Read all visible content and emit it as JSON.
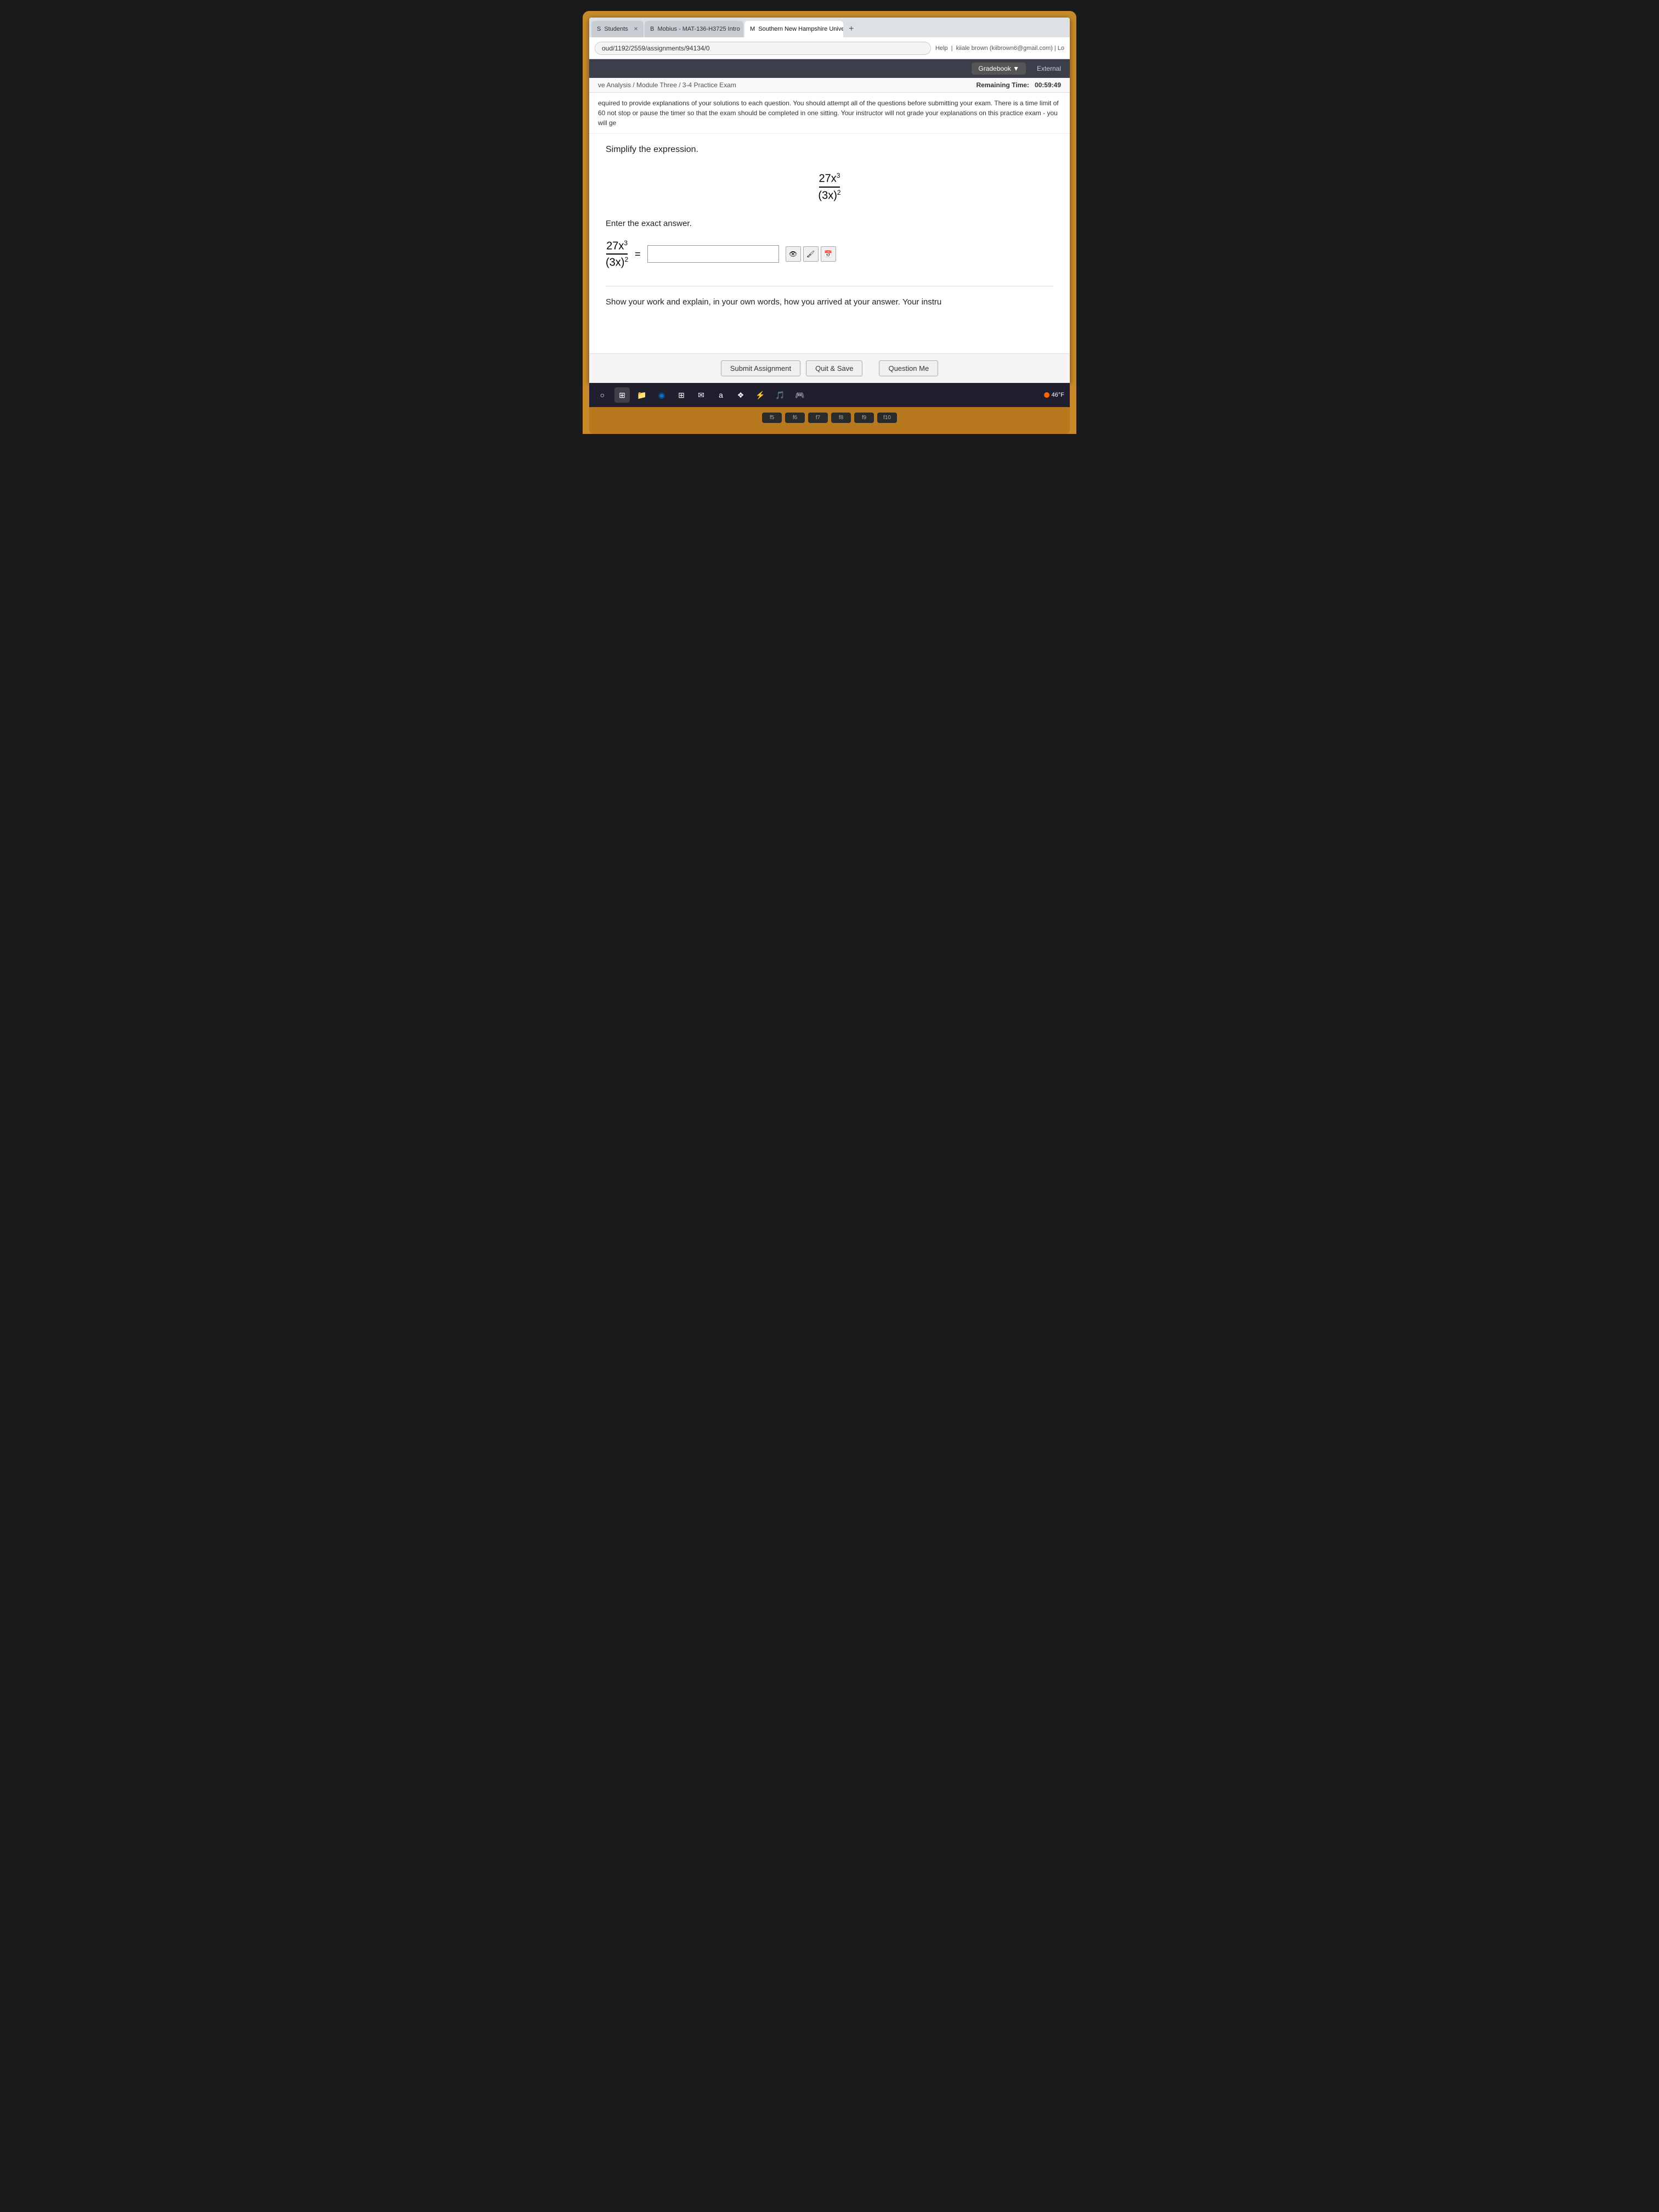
{
  "tabs": [
    {
      "id": "students",
      "label": "Students",
      "icon": "S",
      "active": false
    },
    {
      "id": "mobius",
      "label": "Mobius - MAT-136-H3725 Intro",
      "icon": "B",
      "active": false
    },
    {
      "id": "snhu",
      "label": "Southern New Hampshire Univer",
      "icon": "M",
      "active": true
    }
  ],
  "address_bar": {
    "url": "oud/1192/2559/assignments/94134/0",
    "help_text": "Help",
    "user_text": "kiiale brown (kiibrown6@gmail.com) | Lo"
  },
  "header": {
    "gradebook_label": "Gradebook ▼",
    "external_label": "External"
  },
  "breadcrumb": {
    "items": [
      "ve Analysis",
      "Module Three",
      "3-4 Practice Exam"
    ],
    "separator": "/",
    "remaining_time_label": "Remaining Time:",
    "remaining_time_value": "00:59:49"
  },
  "instructions": {
    "text": "equired to provide explanations of your solutions to each question. You should attempt all of the questions before submitting your exam. There is a time limit of 60 not stop or pause the timer so that the exam should be completed in one sitting. Your instructor will not grade your explanations on this practice exam - you will ge"
  },
  "question": {
    "prompt": "Simplify the expression.",
    "expression_numerator": "27x³",
    "expression_denominator": "(3x)²",
    "answer_prompt": "Enter the exact answer.",
    "answer_label_num": "27x³",
    "answer_label_den": "(3x)²",
    "equals": "=",
    "input_placeholder": "",
    "show_work_label": "Show your work and explain, in your own words, how you arrived at your answer.",
    "show_work_suffix": "Your instru"
  },
  "footer": {
    "submit_label": "Submit Assignment",
    "quit_save_label": "Quit & Save",
    "question_me_label": "Question Me"
  },
  "taskbar": {
    "temperature": "46°F",
    "icons": [
      "⊙",
      "⊞",
      "📁",
      "◉",
      "⊞",
      "✉",
      "a",
      "❖",
      "⚡",
      "🎵",
      "🎮"
    ]
  },
  "keyboard": {
    "keys": [
      "f5",
      "f6",
      "f7",
      "f8",
      "f9",
      "f10"
    ]
  }
}
